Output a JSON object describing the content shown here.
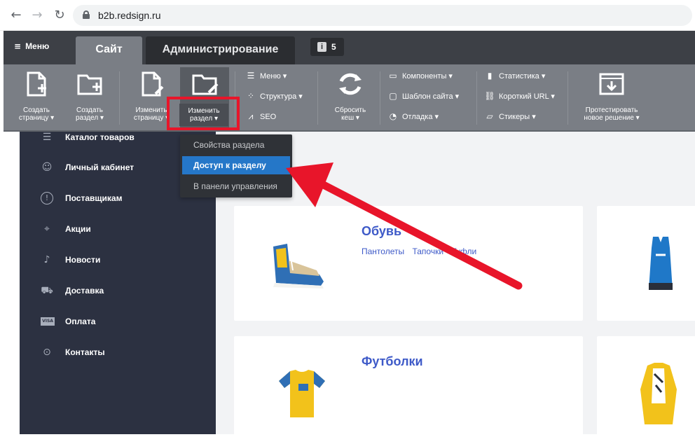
{
  "browser": {
    "url": "b2b.redsign.ru",
    "back_icon": "←",
    "forward_icon": "→",
    "reload_icon": "↻"
  },
  "admin": {
    "menu_label": "Меню",
    "tabs": [
      {
        "label": "Сайт"
      },
      {
        "label": "Администрирование"
      }
    ],
    "notifications": {
      "count": "5",
      "icon": "i"
    },
    "toolbar": {
      "create_page": {
        "line1": "Создать",
        "line2": "страницу ▾"
      },
      "create_section": {
        "line1": "Создать",
        "line2": "раздел ▾"
      },
      "edit_page": {
        "line1": "Изменить",
        "line2": "страницу ▾"
      },
      "edit_section": {
        "line1": "Изменить",
        "line2": "раздел ▾"
      },
      "menu": "Меню ▾",
      "structure": "Структура ▾",
      "seo": "SEO",
      "reset_cache": {
        "line1": "Сбросить",
        "line2": "кеш ▾"
      },
      "components": "Компоненты ▾",
      "site_template": "Шаблон сайта ▾",
      "debug": "Отладка ▾",
      "statistics": "Статистика ▾",
      "short_url": "Короткий URL ▾",
      "stickers": "Стикеры ▾",
      "test_solution": {
        "line1": "Протестировать",
        "line2": "новое решение ▾"
      }
    }
  },
  "dropdown": {
    "items": [
      {
        "label": "Свойства раздела"
      },
      {
        "label": "Доступ к разделу"
      },
      {
        "label": "В панели управления"
      }
    ]
  },
  "sidebar": {
    "items": [
      {
        "label": "Каталог товаров",
        "icon": "list-icon"
      },
      {
        "label": "Личный кабинет",
        "icon": "user-gear-icon"
      },
      {
        "label": "Поставщикам",
        "icon": "alert-circle-icon"
      },
      {
        "label": "Акции",
        "icon": "tag-icon"
      },
      {
        "label": "Новости",
        "icon": "bell-icon"
      },
      {
        "label": "Доставка",
        "icon": "truck-icon"
      },
      {
        "label": "Оплата",
        "icon": "visa-icon"
      },
      {
        "label": "Контакты",
        "icon": "location-pin-icon"
      }
    ],
    "visa_text": "VISA"
  },
  "catalog": {
    "cards": [
      {
        "title": "Обувь",
        "links": [
          "Пантолеты",
          "Тапочки",
          "Туфли"
        ]
      },
      {
        "title": "Футболки",
        "links": []
      }
    ]
  },
  "colors": {
    "accent": "#2577c8",
    "highlight": "#e8152a",
    "link": "#3e5ac8",
    "sidebar_bg": "#2c3141"
  }
}
